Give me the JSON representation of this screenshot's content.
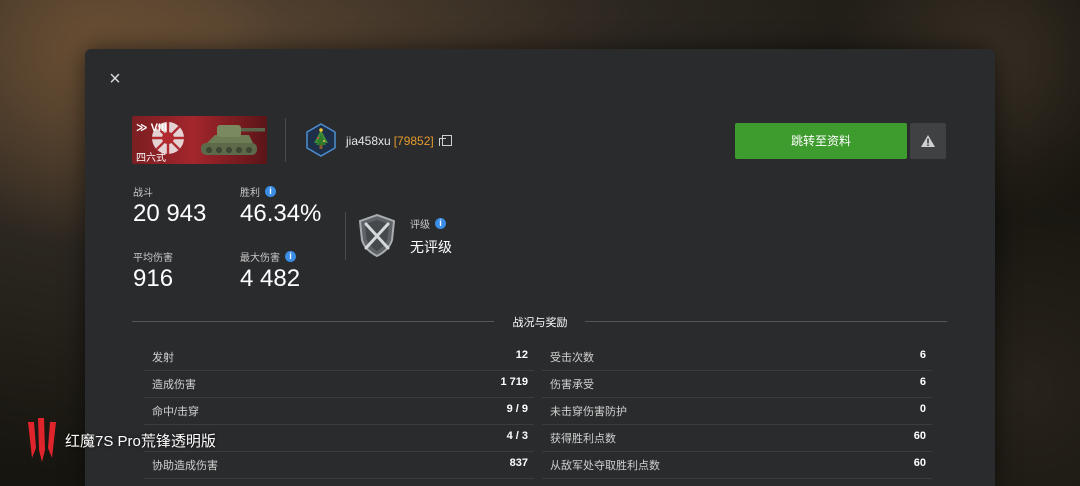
{
  "close": {
    "label": "×"
  },
  "tank": {
    "rank": "VIII",
    "name": "四六式"
  },
  "player": {
    "name": "jia458xu",
    "clan_id": "[79852]"
  },
  "actions": {
    "goto_profile": "跳转至资料",
    "report_icon": "warning-icon"
  },
  "stats": {
    "battles": {
      "label": "战斗",
      "value": "20 943"
    },
    "winrate": {
      "label": "胜利",
      "value": "46.34%"
    },
    "avg_damage": {
      "label": "平均伤害",
      "value": "916"
    },
    "max_damage": {
      "label": "最大伤害",
      "value": "4 482"
    }
  },
  "rating": {
    "label": "评级",
    "value": "无评级"
  },
  "section": {
    "title": "战况与奖励"
  },
  "table": {
    "left": [
      {
        "label": "发射",
        "value": "12"
      },
      {
        "label": "造成伤害",
        "value": "1 719"
      },
      {
        "label": "命中/击穿",
        "value": "9 / 9"
      },
      {
        "label": "",
        "value": "4 / 3"
      },
      {
        "label": "协助造成伤害",
        "value": "837"
      }
    ],
    "right": [
      {
        "label": "受击次数",
        "value": "6"
      },
      {
        "label": "伤害承受",
        "value": "6"
      },
      {
        "label": "未击穿伤害防护",
        "value": "0"
      },
      {
        "label": "获得胜利点数",
        "value": "60"
      },
      {
        "label": "从敌军处夺取胜利点数",
        "value": "60"
      }
    ]
  },
  "watermark": {
    "text": "红魔7S Pro荒锋透明版"
  },
  "colors": {
    "accent_green": "#3e9b2e",
    "clan_orange": "#e59b2e",
    "info_blue": "#3a8ee6",
    "tank_card_red": "#a3262c"
  }
}
